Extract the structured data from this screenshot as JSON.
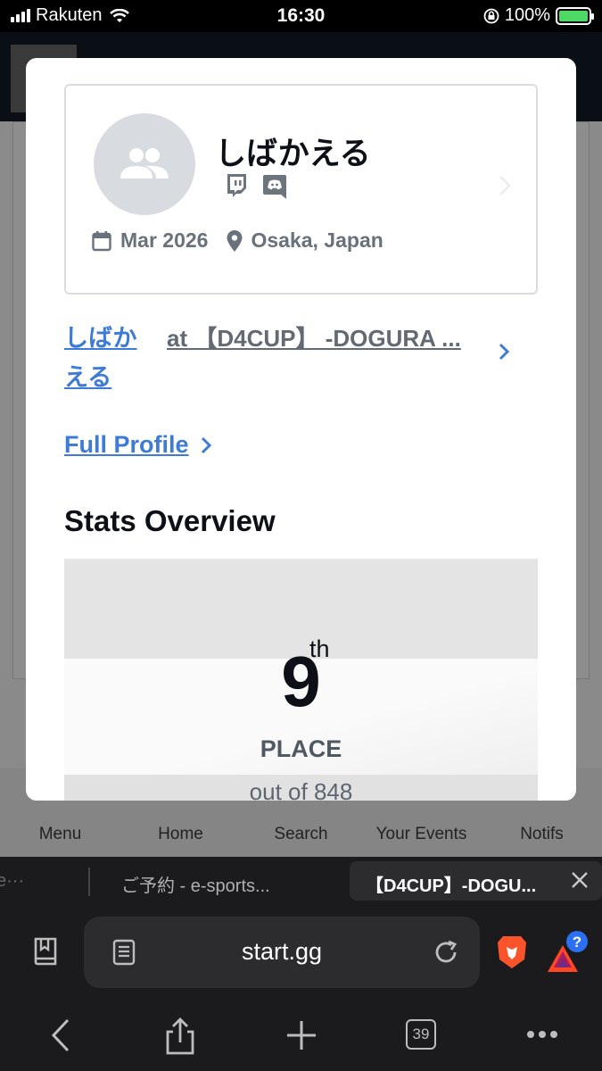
{
  "status_bar": {
    "carrier": "Rakuten",
    "time": "16:30",
    "battery": "100%"
  },
  "background_nav": {
    "items": [
      {
        "label": "Menu",
        "icon": "hamburger-icon"
      },
      {
        "label": "Home",
        "icon": "home-icon"
      },
      {
        "label": "Search",
        "icon": "search-icon"
      },
      {
        "label": "Your Events",
        "icon": "star-calendar-icon"
      },
      {
        "label": "Notifs",
        "icon": "bell-icon"
      }
    ]
  },
  "profile": {
    "name": "しばかえる",
    "social": [
      "twitch-icon",
      "discord-icon"
    ],
    "joined": "Mar 2026",
    "location": "Osaka, Japan"
  },
  "event_link": {
    "player": "しばかえる",
    "event": "at 【D4CUP】 -DOGURA ..."
  },
  "full_profile": {
    "label": "Full Profile"
  },
  "stats": {
    "title": "Stats Overview",
    "place": "9",
    "place_suffix": "th",
    "place_label": "PLACE",
    "out_of": "out of 848"
  },
  "browser": {
    "prev_tab": "e···",
    "other_tab": "ご予約 - e-sports...",
    "active_tab": "【D4CUP】-DOGU...",
    "url": "start.gg",
    "tab_count": "39"
  },
  "colors": {
    "link": "#3d7bd6",
    "battery": "#4cd964",
    "brave": "#fb542b"
  }
}
